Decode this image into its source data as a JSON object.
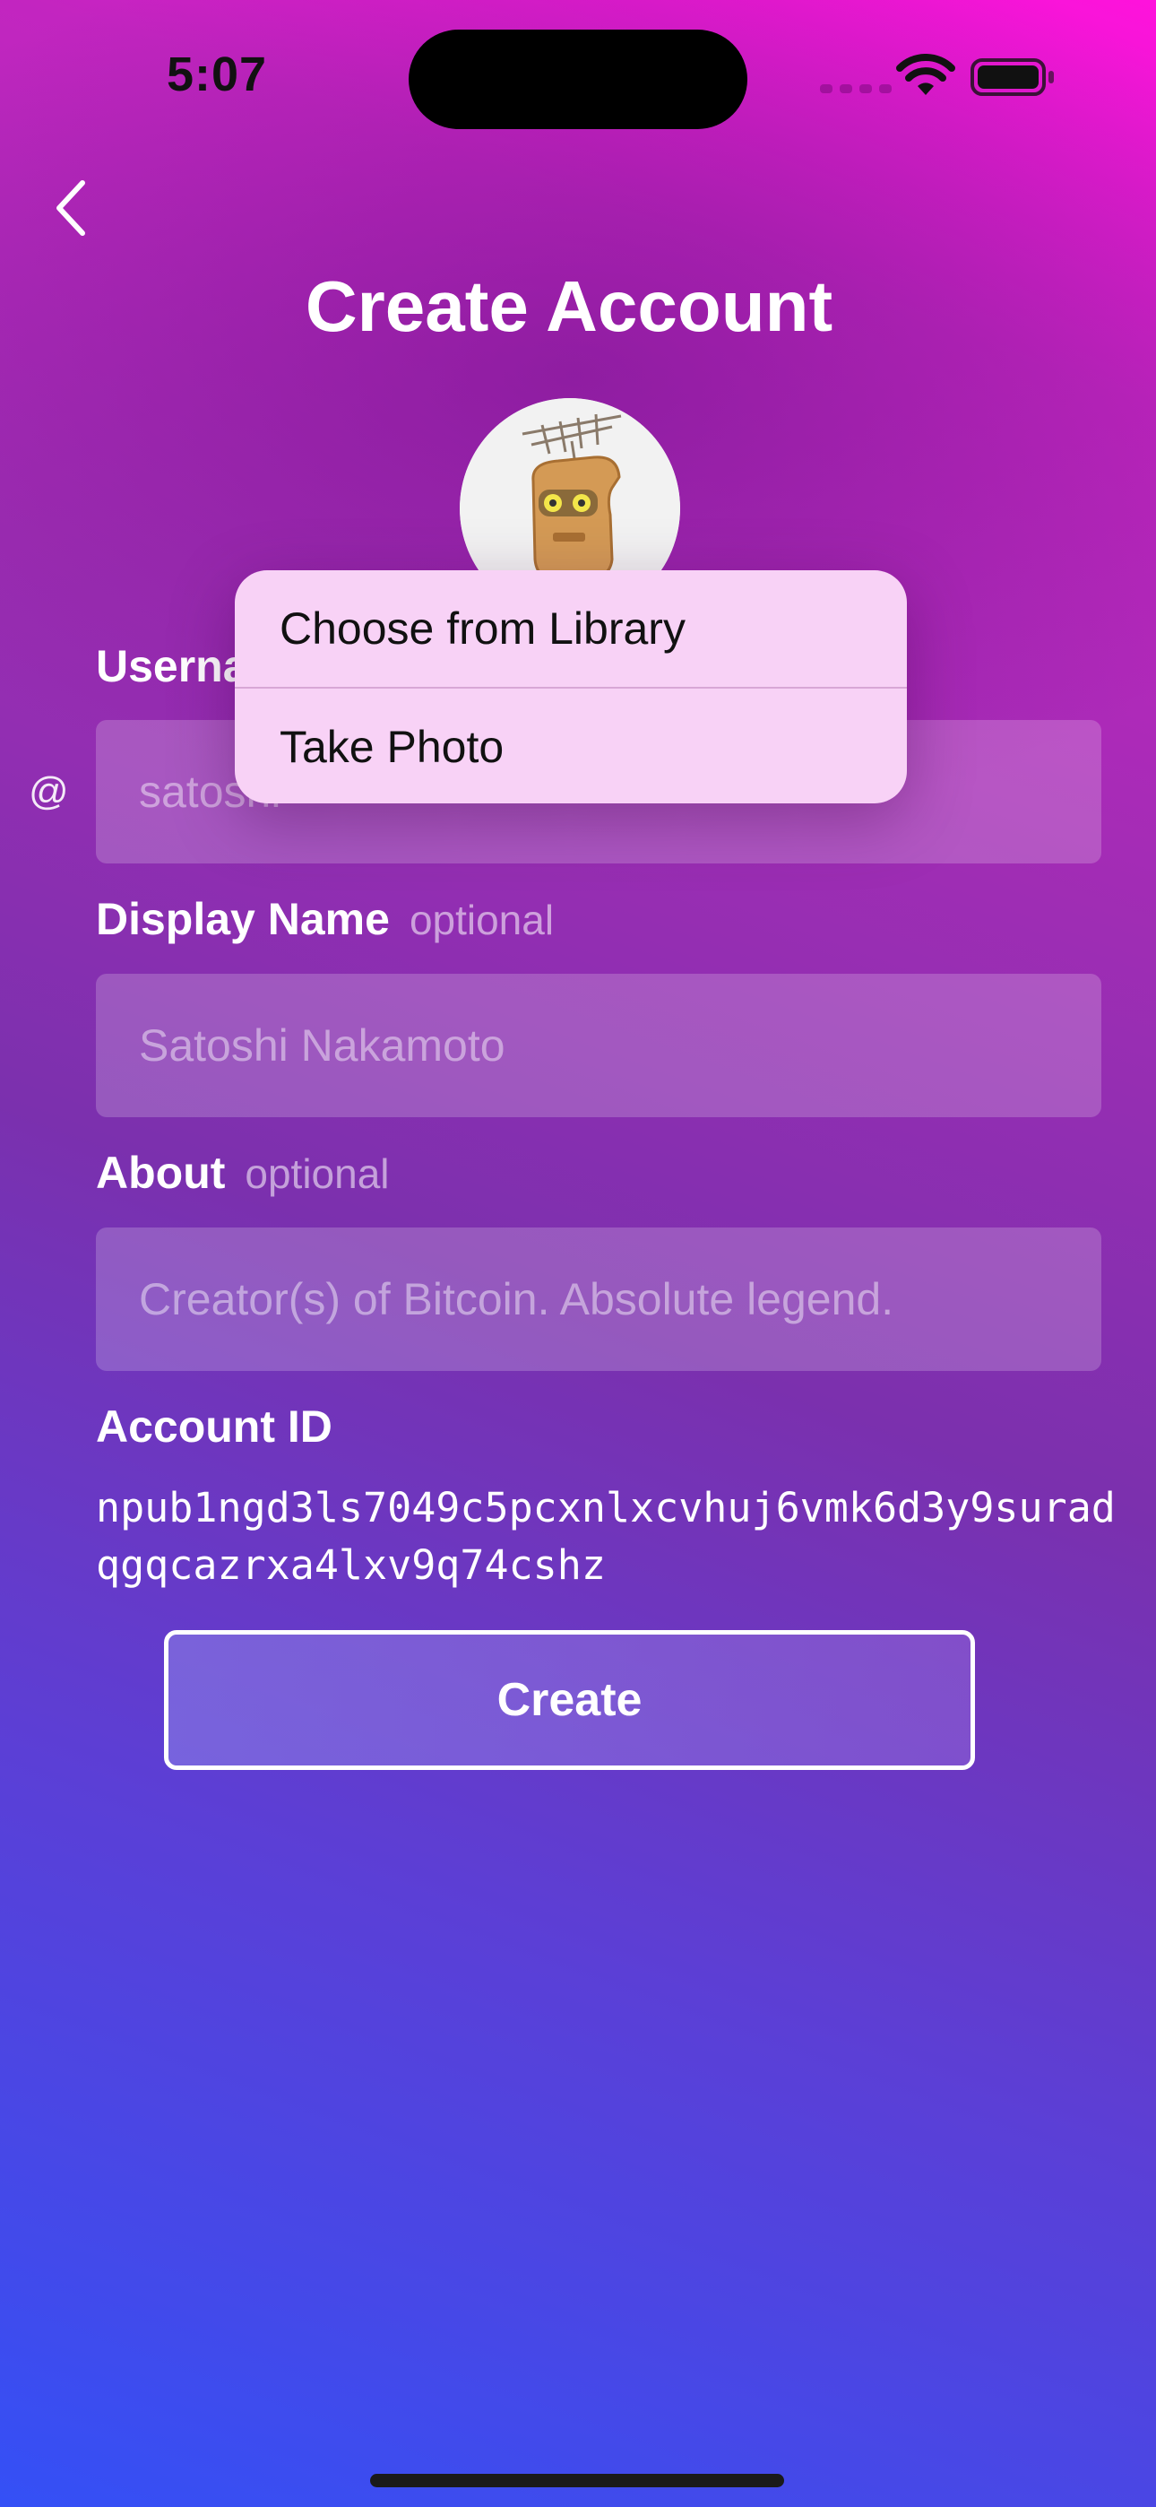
{
  "status_bar": {
    "time": "5:07"
  },
  "nav": {
    "back_icon": "chevron-left-icon",
    "title": "Create Account"
  },
  "avatar": {
    "icon": "robot-avatar"
  },
  "context_menu": {
    "items": [
      {
        "label": "Choose from Library"
      },
      {
        "label": "Take Photo"
      }
    ]
  },
  "form": {
    "username": {
      "label": "Username",
      "prefix": "@",
      "placeholder": "satoshi",
      "value": ""
    },
    "display_name": {
      "label": "Display Name",
      "optional": "optional",
      "placeholder": "Satoshi Nakamoto",
      "value": ""
    },
    "about": {
      "label": "About",
      "optional": "optional",
      "placeholder": "Creator(s) of Bitcoin. Absolute legend.",
      "value": ""
    },
    "account_id": {
      "label": "Account ID",
      "value": "npub1ngd3ls7049c5pcxnlxcvhuj6vmk6d3y9suradqgqcazrxa4lxv9q74cshz"
    },
    "create_label": "Create"
  },
  "colors": {
    "gradient_top": "#ff12dc",
    "gradient_mid": "#7b30ae",
    "gradient_bottom": "#3450f6",
    "menu_background": "#f8d2f6"
  }
}
